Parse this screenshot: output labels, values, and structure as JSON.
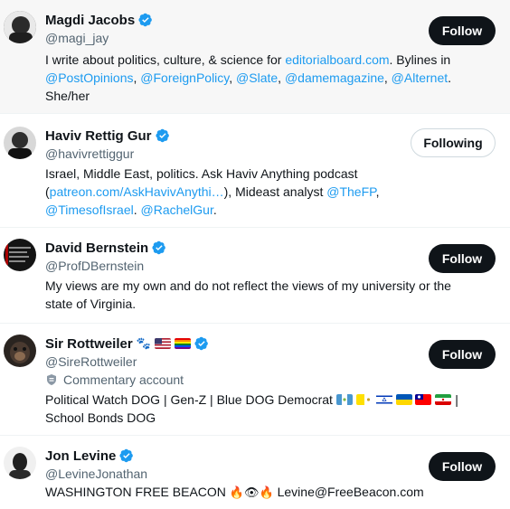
{
  "users": [
    {
      "name": "Magdi Jacobs",
      "handle": "@magi_jay",
      "button": "Follow",
      "bio": [
        {
          "t": "I write about politics, culture, & science for ",
          "link": false
        },
        {
          "t": "editorialboard.com",
          "link": true
        },
        {
          "t": ". Bylines in ",
          "link": false
        },
        {
          "t": "@PostOpinions",
          "link": true
        },
        {
          "t": ", ",
          "link": false
        },
        {
          "t": "@ForeignPolicy",
          "link": true
        },
        {
          "t": ", ",
          "link": false
        },
        {
          "t": "@Slate",
          "link": true
        },
        {
          "t": ", ",
          "link": false
        },
        {
          "t": "@damemagazine",
          "link": true
        },
        {
          "t": ", ",
          "link": false
        },
        {
          "t": "@Alternet",
          "link": true
        },
        {
          "t": ". She/her",
          "link": false
        }
      ]
    },
    {
      "name": "Haviv Rettig Gur",
      "handle": "@havivrettiggur",
      "button": "Following",
      "bio": [
        {
          "t": "Israel, Middle East, politics. Ask Haviv Anything podcast (",
          "link": false
        },
        {
          "t": "patreon.com/AskHavivAnythi…",
          "link": true
        },
        {
          "t": "), Mideast analyst ",
          "link": false
        },
        {
          "t": "@TheFP",
          "link": true
        },
        {
          "t": ", ",
          "link": false
        },
        {
          "t": "@TimesofIsrael",
          "link": true
        },
        {
          "t": ". ",
          "link": false
        },
        {
          "t": "@RachelGur",
          "link": true
        },
        {
          "t": ".",
          "link": false
        }
      ]
    },
    {
      "name": "David Bernstein",
      "handle": "@ProfDBernstein",
      "button": "Follow",
      "bio": [
        {
          "t": "My views are my own and do not reflect the views of my university or the state of Virginia.",
          "link": false
        }
      ]
    },
    {
      "name": "Sir Rottweiler",
      "handle": "@SireRottweiler",
      "button": "Follow",
      "commentary": "Commentary account",
      "bio_part1": "Political Watch DOG | Gen-Z | Blue DOG Democrat",
      "bio_part2": "|",
      "bio_part3": "School Bonds DOG"
    },
    {
      "name": "Jon Levine",
      "handle": "@LevineJonathan",
      "button": "Follow",
      "bio_part1": "WASHINGTON FREE BEACON",
      "bio_emojis": "🔥👁🔥",
      "bio_part2": "Levine@FreeBeacon.com"
    }
  ]
}
